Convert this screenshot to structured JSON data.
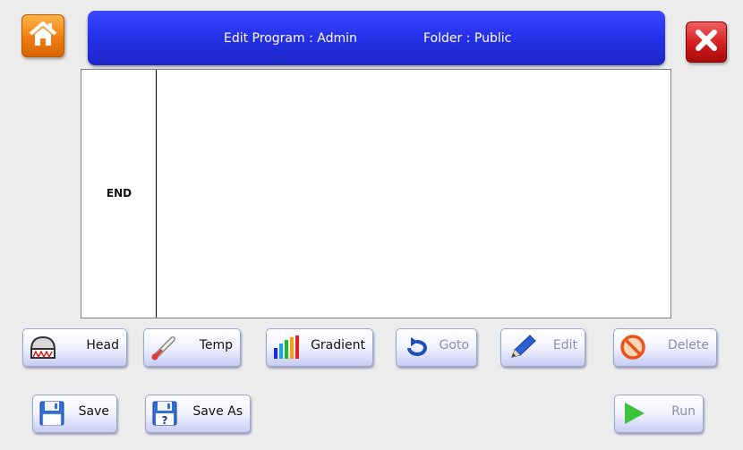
{
  "header": {
    "title": "Edit Program : Admin",
    "folder": "Folder : Public"
  },
  "program": {
    "steps": [
      "END"
    ]
  },
  "toolbar": {
    "head": "Head",
    "temp": "Temp",
    "gradient": "Gradient",
    "goto": "Goto",
    "edit": "Edit",
    "delete": "Delete"
  },
  "footer": {
    "save": "Save",
    "save_as": "Save As",
    "run": "Run"
  },
  "icons": {
    "home": "home-icon",
    "close": "close-icon",
    "head": "thermal-head-icon",
    "temp": "thermometer-icon",
    "gradient": "gradient-bars-icon",
    "goto": "loop-arrow-icon",
    "edit": "pencil-icon",
    "delete": "prohibit-icon",
    "save": "floppy-icon",
    "save_as": "floppy-question-icon",
    "run": "play-icon"
  },
  "colors": {
    "title_bar": "#2530e8",
    "home_button": "#f07d12",
    "close_button": "#d21e1e",
    "run_green": "#3cc23c"
  }
}
